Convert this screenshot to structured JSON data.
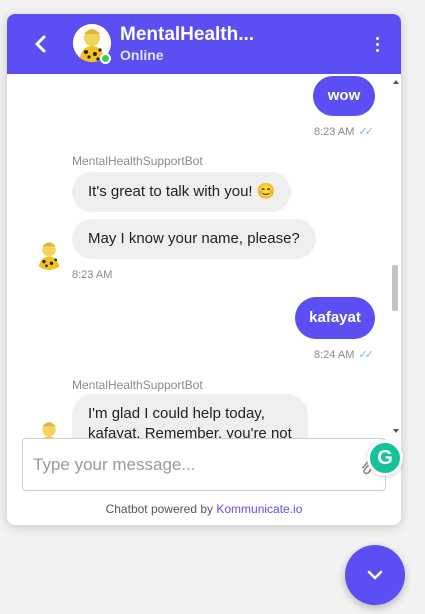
{
  "header": {
    "title": "MentalHealth...",
    "status": "Online"
  },
  "messages": [
    {
      "type": "out",
      "text": "wow",
      "time": "8:23 AM"
    },
    {
      "type": "in",
      "sender": "MentalHealthSupportBot",
      "text": "It's great to talk with you! 😊"
    },
    {
      "type": "in",
      "text": "May I know your name, please?",
      "time": "8:23 AM"
    },
    {
      "type": "out",
      "text": "kafayat",
      "time": "8:24 AM"
    },
    {
      "type": "in",
      "sender": "MentalHealthSupportBot",
      "text_line1": "I'm glad I could help today,",
      "text_line2": "kafayat. Remember, you're not"
    }
  ],
  "composer": {
    "placeholder": "Type your message..."
  },
  "footer": {
    "prefix": "Chatbot powered by ",
    "link": "Kommunicate.io"
  },
  "icons": {
    "back": "chevron-left-icon",
    "more": "more-vertical-icon",
    "attach": "paperclip-icon",
    "grammarly": "grammarly-icon",
    "fab": "chevron-down-icon"
  },
  "colors": {
    "accent": "#5b4ef2",
    "online": "#2fcf5c",
    "read_ticks": "#7eb7f2",
    "grammarly": "#15c39a"
  }
}
